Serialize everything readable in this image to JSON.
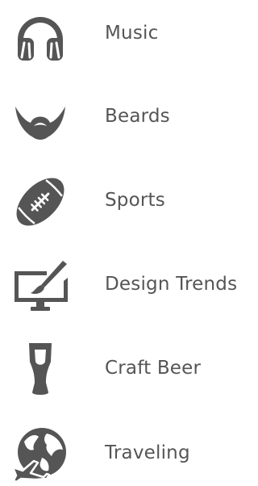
{
  "icon_color": "#555555",
  "text_color": "#555555",
  "interests": [
    {
      "label": "Music",
      "icon": "headphones-icon"
    },
    {
      "label": "Beards",
      "icon": "beard-icon"
    },
    {
      "label": "Sports",
      "icon": "football-icon"
    },
    {
      "label": "Design Trends",
      "icon": "monitor-pen-icon"
    },
    {
      "label": "Craft Beer",
      "icon": "beer-glass-icon"
    },
    {
      "label": "Traveling",
      "icon": "globe-plane-icon"
    }
  ]
}
